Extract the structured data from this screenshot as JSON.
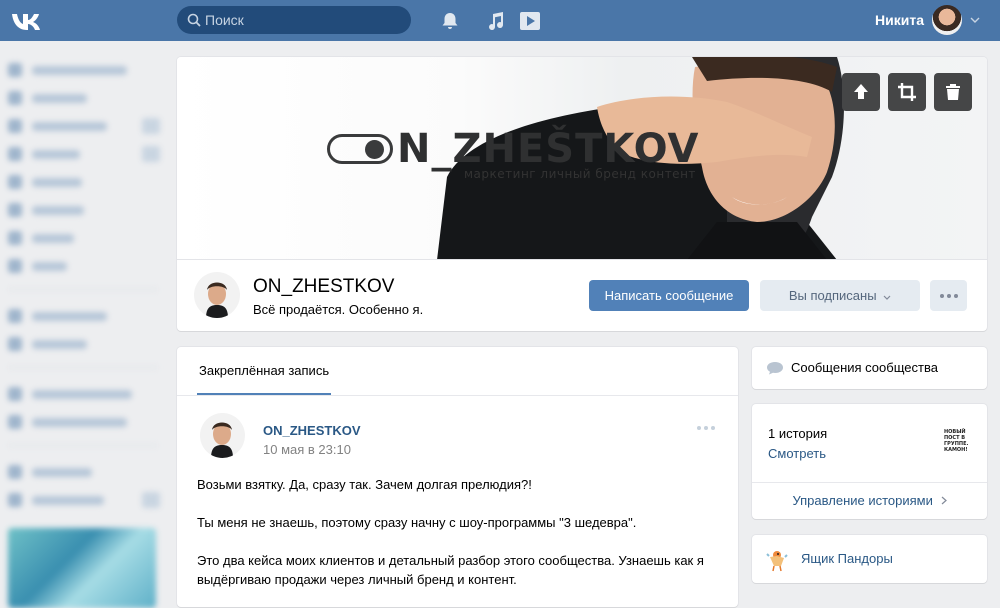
{
  "topbar": {
    "search_placeholder": "Поиск",
    "user_name": "Никита"
  },
  "cover": {
    "brand_name": "N_ZHEŠTKOV",
    "brand_tagline": "маркетинг личный бренд контент"
  },
  "profile": {
    "name": "ON_ZHESTKOV",
    "status": "Всё продаётся. Особенно я.",
    "message_button": "Написать сообщение",
    "subscribed_button": "Вы подписаны"
  },
  "post": {
    "tab_label": "Закреплённая запись",
    "author": "ON_ZHESTKOV",
    "date": "10 мая в 23:10",
    "paragraphs": [
      "Возьми взятку. Да, сразу так. Зачем долгая прелюдия?!",
      "Ты меня не знаешь, поэтому сразу начну с шоу-программы \"3 шедевра\".",
      "Это два кейса моих клиентов и детальный разбор этого сообщества. Узнаешь как я выдёргиваю продажи через личный бренд и контент."
    ]
  },
  "right": {
    "messages_label": "Сообщения сообщества",
    "stories_count": "1 история",
    "stories_view": "Смотреть",
    "stories_thumb": "НОВЫЙ ПОСТ В ГРУППЕ. КАМОН!",
    "stories_manage": "Управление историями",
    "pandora": "Ящик Пандоры"
  },
  "colors": {
    "header": "#4a76a8",
    "accent_button": "#5181b8",
    "link": "#2a5885",
    "page_bg": "#edeef0"
  }
}
